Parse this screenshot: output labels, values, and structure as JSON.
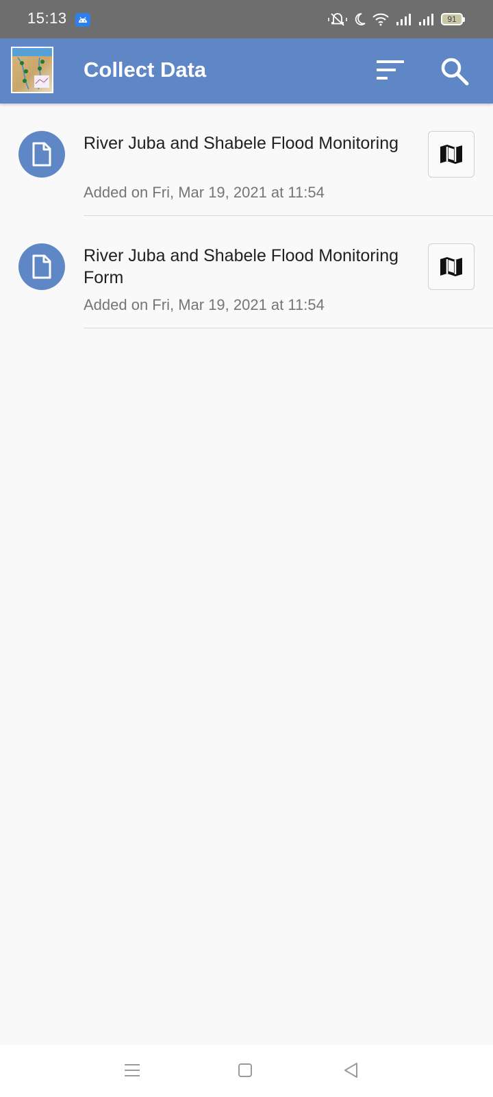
{
  "status_bar": {
    "time": "15:13",
    "battery": "91"
  },
  "app_bar": {
    "title": "Collect Data"
  },
  "forms": [
    {
      "title": "River Juba and Shabele Flood Monitoring",
      "subtitle": "Added on Fri, Mar 19, 2021 at 11:54"
    },
    {
      "title": "River Juba and Shabele Flood Monitoring Form",
      "subtitle": "Added on Fri, Mar 19, 2021 at 11:54"
    }
  ],
  "colors": {
    "primary": "#5f87c6",
    "status_bar": "#6e6e6e",
    "background": "#f9f9f9"
  },
  "icons": [
    "android-notification-icon",
    "mute-icon",
    "moon-icon",
    "wifi-icon",
    "signal-icon",
    "battery-icon",
    "sort-icon",
    "search-icon",
    "form-document-icon",
    "map-icon",
    "menu-nav-icon",
    "home-nav-icon",
    "back-nav-icon"
  ]
}
